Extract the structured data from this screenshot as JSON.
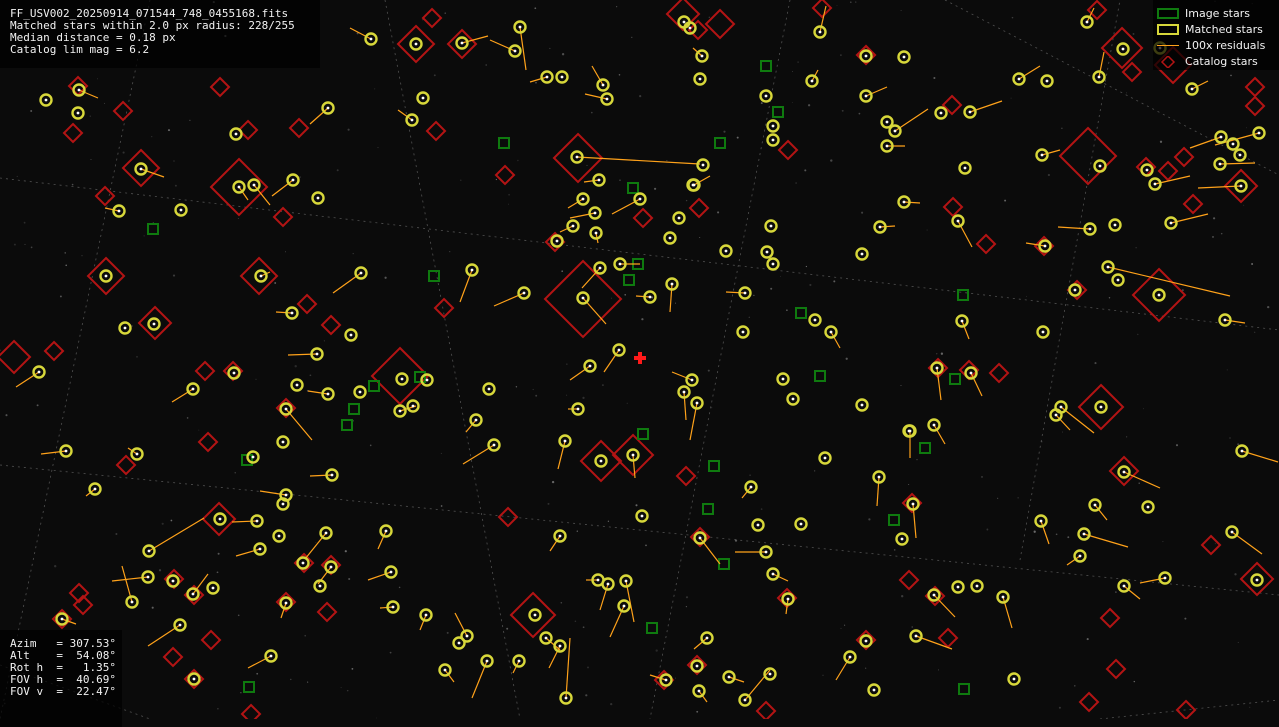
{
  "header": {
    "filename": "FF_USV002_20250914_071544_748_0455168.fits",
    "matched": "Matched stars within 2.0 px radius: 228/255",
    "median": "Median distance = 0.18 px",
    "catalog": "Catalog lim mag = 6.2"
  },
  "pointing": {
    "azim": "Azim   = 307.53°",
    "alt": "Alt    =  54.08°",
    "rot": "Rot h  =   1.35°",
    "fov_h": "FOV h  =  40.69°",
    "fov_v": "FOV v  =  22.47°"
  },
  "legend": {
    "image_stars": "Image stars",
    "matched_stars": "Matched stars",
    "residuals": "100x residuals",
    "catalog_stars": "Catalog stars"
  },
  "colors": {
    "image_star": "#0f7a0f",
    "matched_star": "#d7d73a",
    "residual": "#ffa21a",
    "catalog_star": "#b31414",
    "center_marker": "#ff1a1a",
    "grid": "#8a8a8a"
  }
}
